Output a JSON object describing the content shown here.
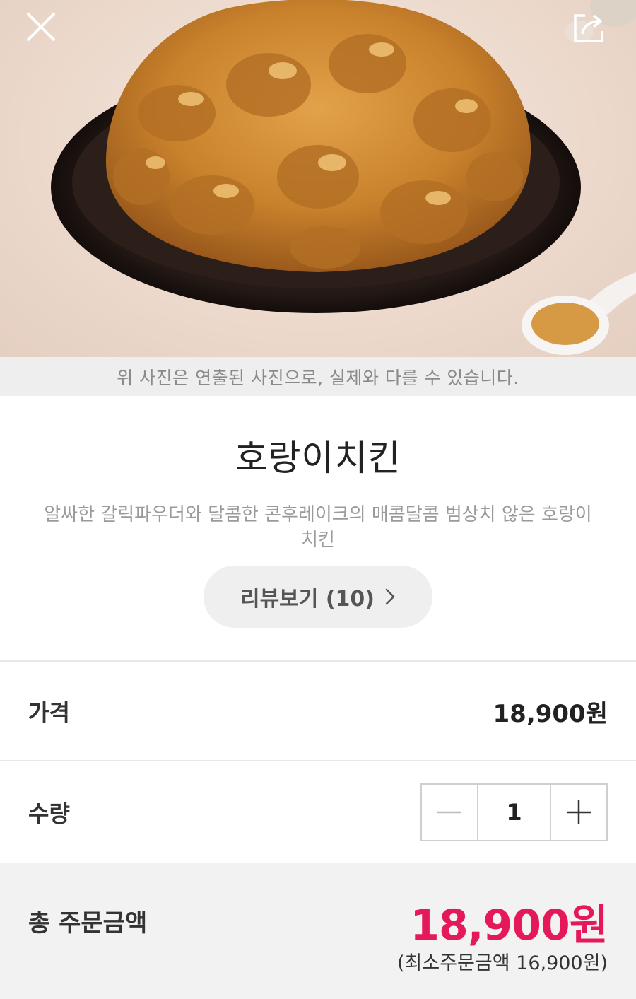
{
  "header": {
    "close_icon": "close-icon",
    "share_icon": "share-icon"
  },
  "photo_note": "위 사진은 연출된 사진으로, 실제와 다를 수 있습니다.",
  "menu": {
    "name": "호랑이치킨",
    "description": "알싸한 갈릭파우더와 달콤한 콘후레이크의 매콤달콤 범상치 않은 호랑이치킨"
  },
  "review_button": {
    "label": "리뷰보기",
    "count": "(10)",
    "icon": "chevron-right-icon"
  },
  "price": {
    "label": "가격",
    "value": "18,900원"
  },
  "quantity": {
    "label": "수량",
    "value": "1",
    "decrement_icon": "minus-icon",
    "increment_icon": "plus-icon"
  },
  "total": {
    "label": "총 주문금액",
    "amount": "18,900원",
    "min_order": "(최소주문금액 16,900원)"
  },
  "colors": {
    "accent": "#e5195a",
    "note_bg": "#eeeeee",
    "total_bg": "#f2f2f2"
  }
}
